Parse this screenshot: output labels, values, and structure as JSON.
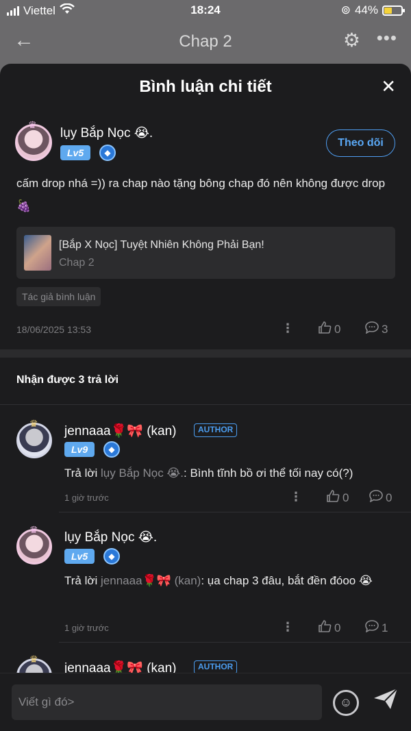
{
  "status_bar": {
    "carrier": "Viettel",
    "time": "18:24",
    "battery": "44%",
    "battery_level": 0.44
  },
  "header": {
    "title": "Chap 2"
  },
  "sheet": {
    "title": "Bình luận chi tiết",
    "comment": {
      "user": "lụy Bắp Nọc 😭.",
      "level": "Lv5",
      "follow_label": "Theo dõi",
      "text": "cấm drop nhá =)) ra chap nào tặng bông chap đó nên không được drop 🍇",
      "manga_title": "[Bắp X Nọc] Tuyệt Nhiên Không Phải Bạn!",
      "manga_chapter": "Chap 2",
      "tag": "Tác giả bình luận",
      "date": "18/06/2025 13:53",
      "likes": "0",
      "replies": "3"
    },
    "replies_title": "Nhận được 3 trả lời",
    "replies": [
      {
        "user": "jennaaa🌹🎀 (kan)",
        "author_badge": "AUTHOR",
        "level": "Lv9",
        "prefix": "Trả lời ",
        "mention": "lụy Bắp Nọc 😭.",
        "text": ": Bình tĩnh bồ ơi thể tối nay có(?)",
        "time": "1 giờ trước",
        "likes": "0",
        "replies": "0"
      },
      {
        "user": "lụy Bắp Nọc 😭.",
        "level": "Lv5",
        "prefix": "Trả lời ",
        "mention": "jennaaa🌹🎀 (kan)",
        "text": ": ụa chap 3 đâu, bắt đền đóoo 😭",
        "time": "1 giờ trước",
        "likes": "0",
        "replies": "1"
      },
      {
        "user": "jennaaa🌹🎀 (kan)",
        "author_badge": "AUTHOR"
      }
    ],
    "input_placeholder": "Viết gì đó>"
  },
  "colors": {
    "accent": "#4f9ef2",
    "level_badge": "#5fa9ef",
    "sheet_bg": "#1c1c1e"
  }
}
